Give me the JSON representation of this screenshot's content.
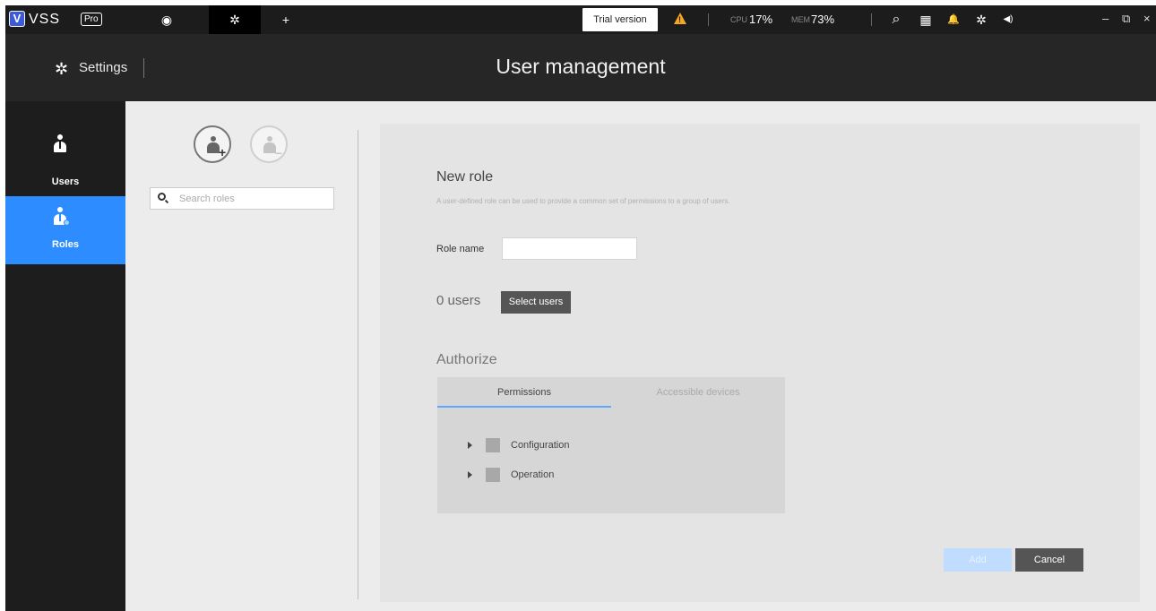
{
  "topbar": {
    "brand": "VSS",
    "brand_logo_letter": "V",
    "edition": "Pro",
    "tabs": [
      {
        "icon": "eye-icon",
        "glyph": "◉"
      },
      {
        "icon": "gear-icon",
        "glyph": "✲"
      },
      {
        "icon": "plus-icon",
        "glyph": "+"
      }
    ],
    "trial_label": "Trial version",
    "warning_glyph": "!",
    "cpu_label": "CPU",
    "cpu_value": "17%",
    "mem_label": "MEM",
    "mem_value": "73%",
    "icons": {
      "search": "⌕",
      "grid": "▦",
      "bell": "🔔",
      "settings": "✲",
      "volume": "◀)"
    },
    "window": {
      "minimize": "–",
      "restore": "⧉",
      "close": "×"
    }
  },
  "header": {
    "section": "Settings",
    "title": "User management",
    "section_icon": "✲"
  },
  "nav": {
    "items": [
      {
        "label": "Users",
        "active": false
      },
      {
        "label": "Roles",
        "active": true
      }
    ]
  },
  "roles_panel": {
    "add_sign": "+",
    "remove_sign": "–",
    "search_placeholder": "Search roles"
  },
  "form": {
    "title": "New role",
    "description": "A user-defined role can be used to provide a common set of permissions to a group of users.",
    "role_name_label": "Role name",
    "role_name_value": "",
    "users_count": "0 users",
    "select_users_label": "Select users",
    "authorize_title": "Authorize",
    "tabs": [
      "Permissions",
      "Accessible devices"
    ],
    "tree": [
      "Configuration",
      "Operation"
    ],
    "add_label": "Add",
    "cancel_label": "Cancel"
  },
  "colors": {
    "accent": "#2d8cff",
    "topbar": "#1c1c1c",
    "header": "#262626",
    "warning": "#f5a623"
  }
}
